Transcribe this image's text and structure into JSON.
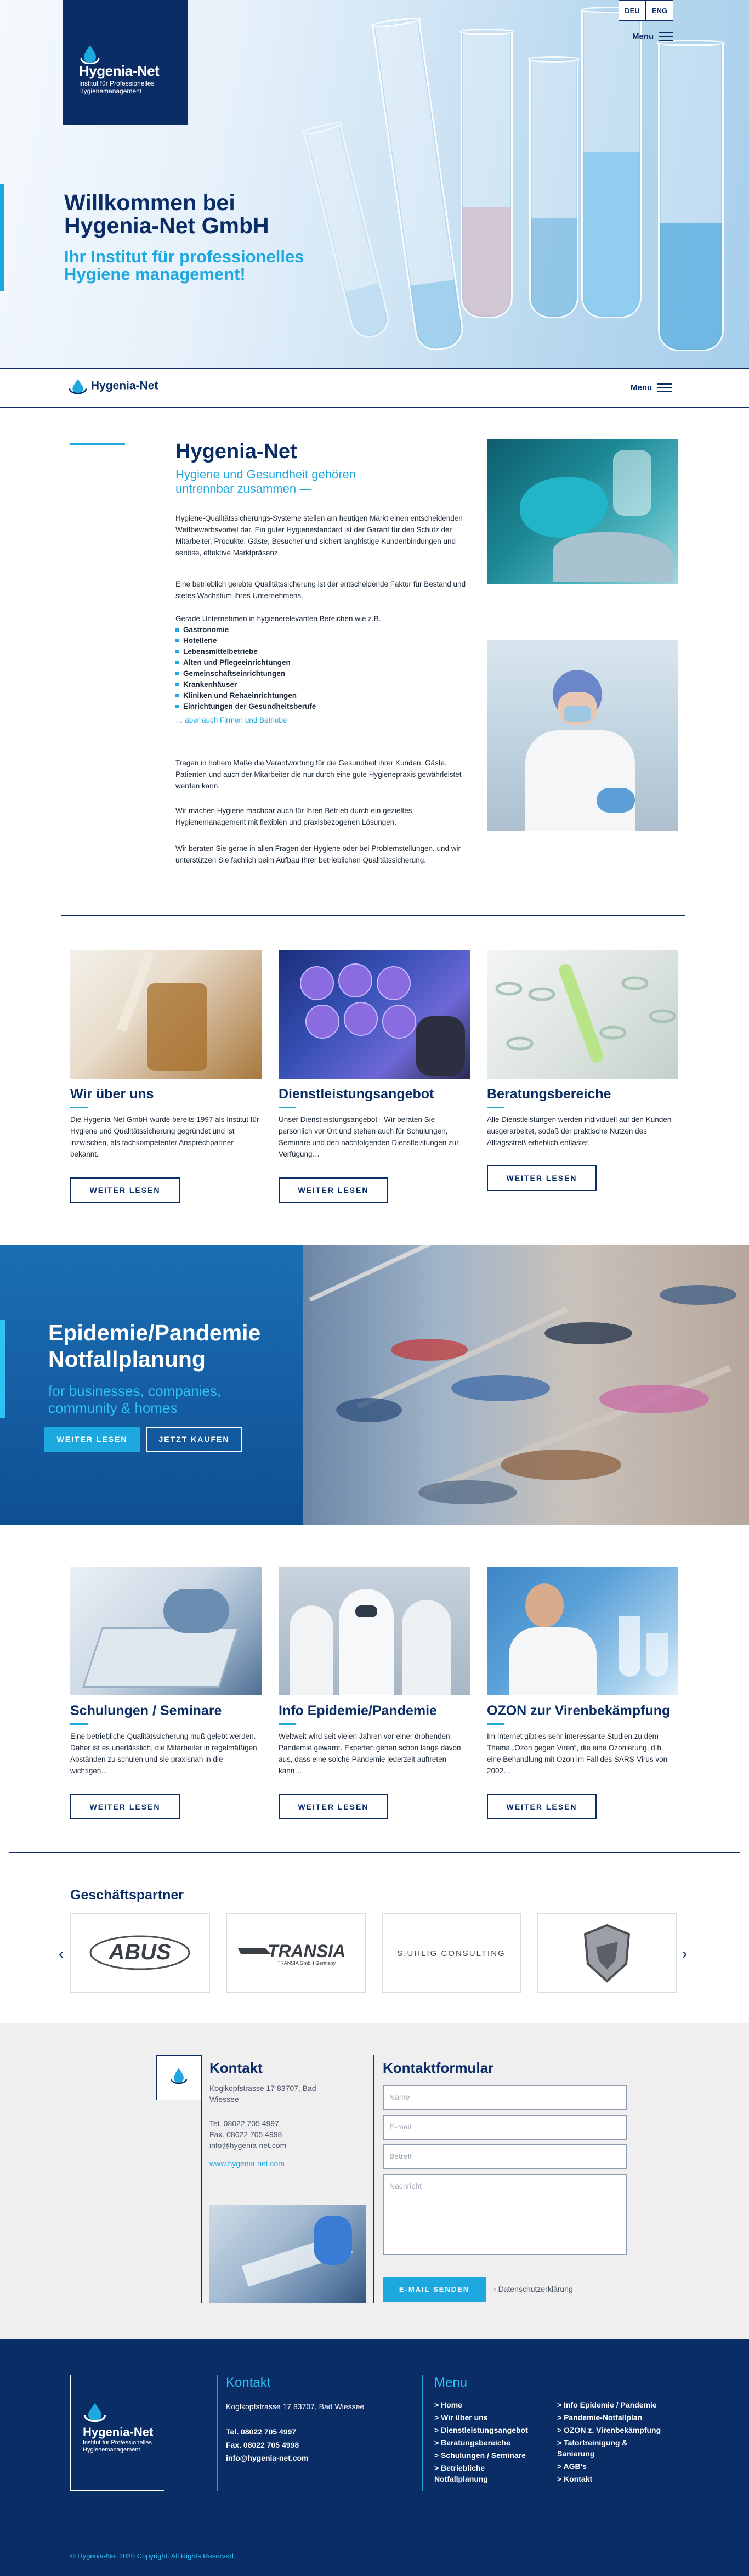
{
  "brand": {
    "name": "Hygenia-Net",
    "tagline_line1": "Institut für Professionelles",
    "tagline_line2": "Hygienemanagement"
  },
  "header": {
    "lang_de": "DEU",
    "lang_en": "ENG",
    "menu_label": "Menu"
  },
  "hero": {
    "title_line1": "Willkommen bei",
    "title_line2": "Hygenia-Net GmbH",
    "subtitle_line1": "Ihr Institut für professionelles",
    "subtitle_line2": "Hygiene management!"
  },
  "intro": {
    "title": "Hygenia-Net",
    "subtitle": "Hygiene und Gesundheit gehören untrennbar zusammen —",
    "p1": "Hygiene-Qualitätssicherungs-Systeme stellen am heutigen Markt einen entscheidenden Wettbewerbsvorteil dar. Ein guter Hygienestandard ist der Garant für den Schutz der Mitarbeiter, Produkte, Gäste, Besucher und sichert langfristige Kundenbindungen und seriöse, effektive Marktpräsenz.",
    "p2": "Eine betrieblich gelebte Qualitätssicherung ist der entscheidende Faktor für Bestand und stetes Wachstum Ihres Unternehmens.",
    "p3": "Gerade Unternehmen in hygienerelevanten Bereichen wie z.B.",
    "bullets": [
      "Gastronomie",
      "Hotellerie",
      "Lebensmittelbetriebe",
      "Alten und Pflegeeinrichtungen",
      "Gemeinschaftseinrichtungen",
      "Krankenhäuser",
      "Kliniken und Rehaeinrichtungen",
      "Einrichtungen der Gesundheitsberufe"
    ],
    "bullets_more": "… aber auch Firmen und Betriebe",
    "p4": "Tragen in hohem Maße die Verantwortung für die Gesundheit ihrer Kunden, Gäste, Patienten und auch der Mitarbeiter die nur durch eine gute Hygienepraxis gewährleistet werden kann.",
    "p5": "Wir machen Hygiene machbar auch für Ihren Betrieb durch ein gezieltes Hygienemanagement mit flexiblen und praxisbezogenen Lösungen.",
    "p6": "Wir beraten Sie gerne in allen Fragen der Hygiene oder bei Problemstellungen, und wir unterstützen Sie fachlich beim Aufbau Ihrer betrieblichen Qualitätssicherung."
  },
  "cards_row1": [
    {
      "title": "Wir über uns",
      "text": "Die Hygenia-Net GmbH wurde bereits 1997 als Institut für Hygiene und Qualitätssicherung gegründet und ist inzwischen, als fachkompetenter Ansprechpartner bekannt.",
      "button": "WEITER LESEN"
    },
    {
      "title": "Dienstleistungsangebot",
      "text": "Unser Dienstleistungsangebot - Wir beraten Sie persönlich vor Ort und stehen auch für Schulungen, Seminare und den nachfolgenden Dienstleistungen zur Verfügung…",
      "button": "WEITER LESEN"
    },
    {
      "title": "Beratungsbereiche",
      "text": "Alle Dienstleistungen werden individuell auf den Kunden ausgerarbeitet, sodaß der praktische Nutzen des Alltagsstreß erheblich entlastet.",
      "button": "WEITER LESEN"
    }
  ],
  "epidemic": {
    "title_line1": "Epidemie/Pandemie",
    "title_line2": "Notfallplanung",
    "subtitle": "for businesses, companies, community & homes",
    "btn_more": "WEITER LESEN",
    "btn_buy": "JETZT KAUFEN"
  },
  "cards_row2": [
    {
      "title": "Schulungen / Seminare",
      "text": "Eine betriebliche Qualitätssicherung muß gelebt werden. Daher ist es unerlässlich, die Mitarbeiter in regelmäßigen Abständen zu schulen und sie praxisnah in die wichtigen…",
      "button": "WEITER LESEN"
    },
    {
      "title": "Info Epidemie/Pandemie",
      "text": "Weltweit wird seit vielen Jahren vor einer drohenden Pandemie gewarnt. Experten gehen schon lange davon aus, dass eine solche Pandemie jederzeit auftreten kann…",
      "button": "WEITER LESEN"
    },
    {
      "title": "OZON zur Virenbekämpfung",
      "text": "Im Internet gibt es sehr interessante Studien zu dem Thema „Ozon gegen Viren“, die eine Ozonierung, d.h. eine Behandlung mit Ozon im Fall des SARS-Virus von 2002…",
      "button": "WEITER LESEN"
    }
  ],
  "partners": {
    "title": "Geschäftspartner",
    "logos": [
      "ABUS",
      "TRANSIA",
      "TRANSIA GmbH Germany",
      "S.UHLIG CONSULTING"
    ],
    "prev": "‹",
    "next": "›"
  },
  "contact": {
    "title": "Kontakt",
    "address": "Koglkopfstrasse 17 83707, Bad Wiessee",
    "tel": "Tel. 08022 705 4997",
    "fax": "Fax. 08022 705 4998",
    "email": "info@hygenia-net.com",
    "web": "www.hygenia-net.com",
    "form_title": "Kontaktformular",
    "ph_name": "Name",
    "ph_email": "E-mail",
    "ph_subject": "Betreff",
    "ph_message": "Nachricht",
    "send": "E-MAIL SENDEN",
    "privacy": "Datenschutzerklärung"
  },
  "footer": {
    "contact_title": "Kontakt",
    "address": "Koglkopfstrasse 17 83707, Bad Wiessee",
    "tel": "Tel. 08022 705 4997",
    "fax": "Fax. 08022 705 4998",
    "email": "info@hygenia-net.com",
    "menu_title": "Menu",
    "menu_col1": [
      "> Home",
      "> Wir über uns",
      "> Dienstleistungsangebot",
      "> Beratungsbereiche",
      "> Schulungen / Seminare",
      "> Betriebliche",
      "Notfallplanung"
    ],
    "menu_col2": [
      "> Info Epidemie / Pandemie",
      "> Pandemie-Notfallplan",
      "> OZON z. Virenbekämpfung",
      "> Tatortreinigung &",
      "Sanierung",
      "> AGB's",
      "> Kontakt"
    ],
    "copyright": "© Hygenia-Net 2020 Copyright. All Rights Reserved."
  },
  "colors": {
    "navy": "#0a2d66",
    "accent": "#1ea8e0",
    "light_bg": "#efefef"
  }
}
